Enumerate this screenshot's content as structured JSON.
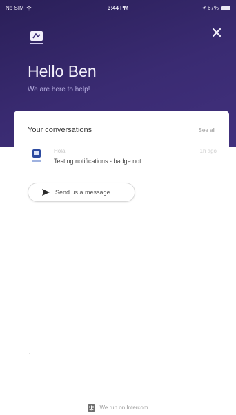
{
  "status_bar": {
    "carrier": "No SIM",
    "time": "3:44 PM",
    "battery": "67%"
  },
  "header": {
    "greeting": "Hello Ben",
    "tagline": "We are here to help!",
    "close_icon": "close-icon",
    "logo_icon": "brand-logo-icon",
    "colors": {
      "background": "#2f2464",
      "greeting_text": "#f2effa",
      "tagline_text": "#b6aee0"
    }
  },
  "conversations": {
    "title": "Your conversations",
    "see_all": "See all",
    "items": [
      {
        "sender": "Hola",
        "time": "1h ago",
        "preview": "Testing notifications - badge not"
      }
    ]
  },
  "actions": {
    "send_message": "Send us a message",
    "send_icon": "send-arrow-icon"
  },
  "footer": {
    "text": "We run on Intercom",
    "icon": "intercom-logo-icon"
  }
}
